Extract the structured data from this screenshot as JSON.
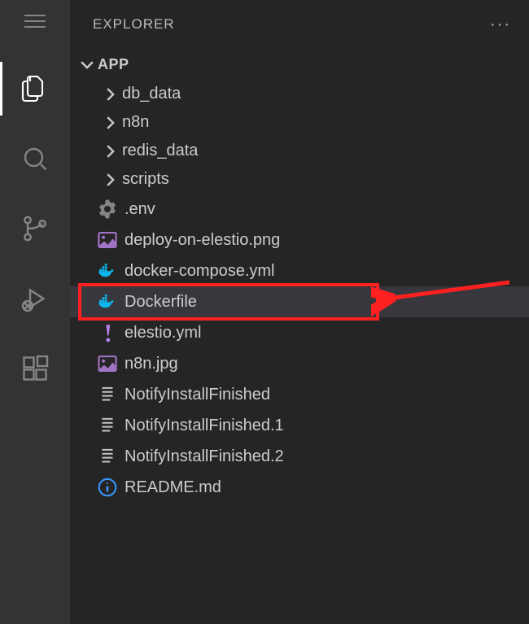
{
  "explorer": {
    "title": "EXPLORER"
  },
  "section": {
    "name": "APP"
  },
  "items": [
    {
      "type": "folder",
      "label": "db_data"
    },
    {
      "type": "folder",
      "label": "n8n"
    },
    {
      "type": "folder",
      "label": "redis_data"
    },
    {
      "type": "folder",
      "label": "scripts"
    },
    {
      "type": "file",
      "icon": "gear",
      "label": ".env"
    },
    {
      "type": "file",
      "icon": "image",
      "label": "deploy-on-elestio.png"
    },
    {
      "type": "file",
      "icon": "docker",
      "label": "docker-compose.yml"
    },
    {
      "type": "file",
      "icon": "docker",
      "label": "Dockerfile",
      "selected": true,
      "highlighted": true
    },
    {
      "type": "file",
      "icon": "exclaim",
      "label": "elestio.yml"
    },
    {
      "type": "file",
      "icon": "image",
      "label": "n8n.jpg"
    },
    {
      "type": "file",
      "icon": "lines",
      "label": "NotifyInstallFinished"
    },
    {
      "type": "file",
      "icon": "lines",
      "label": "NotifyInstallFinished.1"
    },
    {
      "type": "file",
      "icon": "lines",
      "label": "NotifyInstallFinished.2"
    },
    {
      "type": "file",
      "icon": "info",
      "label": "README.md"
    }
  ],
  "highlight": {
    "color": "#ff2020"
  }
}
